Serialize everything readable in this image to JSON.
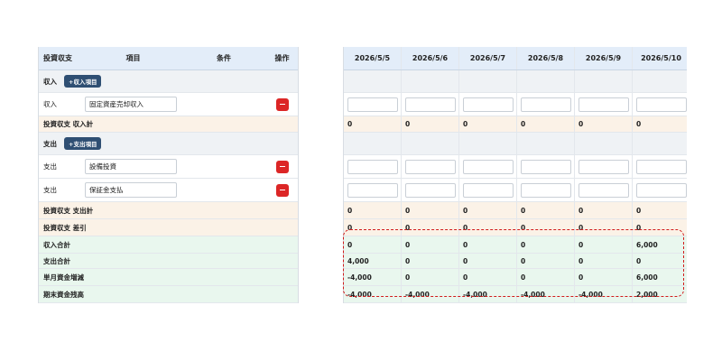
{
  "left_table": {
    "headers": {
      "type": "投資収支",
      "item": "項目",
      "condition": "条件",
      "action": "操作"
    },
    "income_section": {
      "label": "収入",
      "add_button": "+収入項目"
    },
    "income_rows": [
      {
        "type": "収入",
        "item": "固定資産売却収入"
      }
    ],
    "income_subtotal": "投資収支 収入計",
    "expense_section": {
      "label": "支出",
      "add_button": "+支出項目"
    },
    "expense_rows": [
      {
        "type": "支出",
        "item": "設備投資"
      },
      {
        "type": "支出",
        "item": "保証金支払"
      }
    ],
    "expense_subtotal": "投資収支 支出計",
    "difference": "投資収支 差引",
    "totals": {
      "income_total": "収入合計",
      "expense_total": "支出合計",
      "monthly_change": "単月資金増減",
      "ending_balance": "期末資金残高"
    }
  },
  "right_table": {
    "dates": [
      "2026/5/5",
      "2026/5/6",
      "2026/5/7",
      "2026/5/8",
      "2026/5/9",
      "2026/5/10"
    ],
    "income_subtotal": [
      "0",
      "0",
      "0",
      "0",
      "0",
      "0"
    ],
    "expense_subtotal": [
      "0",
      "0",
      "0",
      "0",
      "0",
      "0"
    ],
    "difference": [
      "0",
      "0",
      "0",
      "0",
      "0",
      "0"
    ],
    "income_total": [
      "0",
      "0",
      "0",
      "0",
      "0",
      "6,000"
    ],
    "expense_total": [
      "4,000",
      "0",
      "0",
      "0",
      "0",
      "0"
    ],
    "monthly_change": [
      "-4,000",
      "0",
      "0",
      "0",
      "0",
      "6,000"
    ],
    "ending_balance": [
      "-4,000",
      "-4,000",
      "-4,000",
      "-4,000",
      "-4,000",
      "2,000"
    ]
  },
  "colors": {
    "header_bg": "#e3edf9",
    "section_bg": "#eff2f5",
    "subtotal_bg": "#fbf2e7",
    "total_bg": "#e9f7ee",
    "add_button_bg": "#2f4f73",
    "delete_button_bg": "#dc2626",
    "highlight_border": "#d11c1c"
  },
  "icons": {
    "delete": "minus-icon"
  }
}
